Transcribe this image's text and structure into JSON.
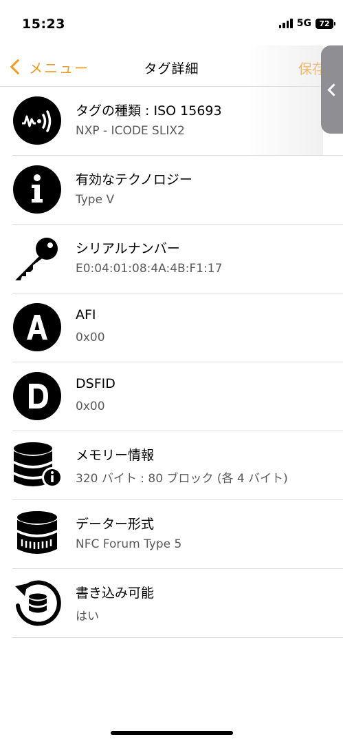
{
  "status": {
    "time": "15:23",
    "network": "5G",
    "battery": "72"
  },
  "nav": {
    "back_label": "メニュー",
    "title": "タグ詳細",
    "save_label": "保存"
  },
  "rows": [
    {
      "title": "タグの種類 : ISO 15693",
      "value": "NXP - ICODE SLIX2",
      "icon": "nfc-signal-icon"
    },
    {
      "title": "有効なテクノロジー",
      "value": "Type V",
      "icon": "info-icon"
    },
    {
      "title": "シリアルナンバー",
      "value": "E0:04:01:08:4A:4B:F1:17",
      "icon": "key-icon"
    },
    {
      "title": "AFI",
      "value": "0x00",
      "icon": "letter-a-icon"
    },
    {
      "title": "DSFID",
      "value": "0x00",
      "icon": "letter-d-icon"
    },
    {
      "title": "メモリー情報",
      "value": "320 バイト : 80 ブロック (各 4 バイト)",
      "icon": "database-info-icon"
    },
    {
      "title": "データー形式",
      "value": "NFC Forum Type 5",
      "icon": "database-format-icon"
    },
    {
      "title": "書き込み可能",
      "value": "はい",
      "icon": "database-writable-icon"
    }
  ],
  "colors": {
    "accent": "#f19c1e",
    "separator": "#dcdcdc",
    "secondary_text": "#5a5a5a"
  }
}
